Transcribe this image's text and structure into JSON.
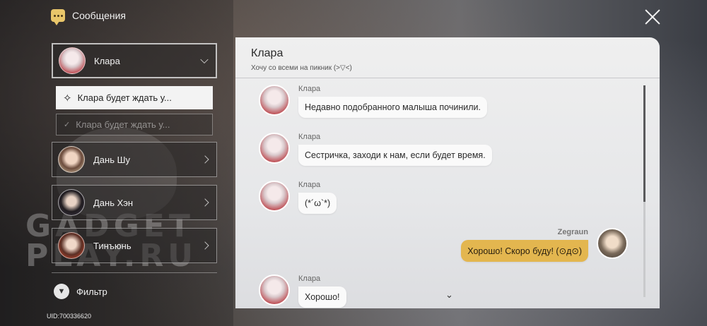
{
  "header": {
    "title": "Сообщения",
    "icon": "message-icon"
  },
  "sidebar": {
    "active_contact": {
      "name": "Клара",
      "avatar": "klara-avatar"
    },
    "tasks": [
      {
        "label": "Клара будет ждать у...",
        "state": "current"
      },
      {
        "label": "Клара будет ждать у...",
        "state": "done"
      }
    ],
    "contacts": [
      {
        "name": "Дань Шу"
      },
      {
        "name": "Дань Хэн"
      },
      {
        "name": "Тинъюнь"
      }
    ],
    "filter_label": "Фильтр",
    "uid": "UID:700336620"
  },
  "watermark": {
    "line1": "GADGET",
    "line2": "PLAY.RU"
  },
  "chat": {
    "title": "Клара",
    "subtitle": "Хочу со всеми на пикник (>▽<)",
    "messages": [
      {
        "sender": "Клара",
        "text": "Недавно подобранного малыша починили.",
        "me": false
      },
      {
        "sender": "Клара",
        "text": "Сестричка, заходи к нам, если будет время.",
        "me": false
      },
      {
        "sender": "Клара",
        "text": "(*´ω`*)",
        "me": false
      },
      {
        "sender": "Zegraun",
        "text": "Хорошо! Скоро буду! (⊙д⊙)",
        "me": true
      },
      {
        "sender": "Клара",
        "text": "Хорошо!",
        "me": false
      }
    ]
  },
  "colors": {
    "accent": "#e3b64f",
    "panel": "#ececec"
  }
}
